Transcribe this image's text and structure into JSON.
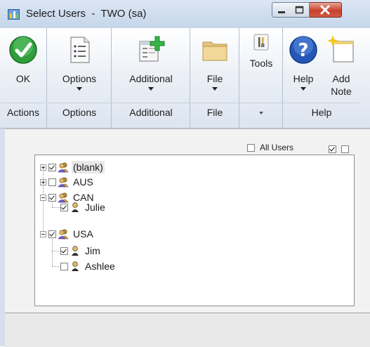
{
  "window": {
    "title": "Select Users  -  TWO (sa)"
  },
  "ribbon": {
    "groups": [
      {
        "label": "Actions",
        "buttons": [
          {
            "label": "OK",
            "icon": "ok-check-icon"
          }
        ]
      },
      {
        "label": "Options",
        "buttons": [
          {
            "label": "Options",
            "icon": "options-list-icon",
            "dropdown": true
          }
        ]
      },
      {
        "label": "Additional",
        "buttons": [
          {
            "label": "Additional",
            "icon": "additional-window-icon",
            "dropdown": true
          }
        ]
      },
      {
        "label": "File",
        "buttons": [
          {
            "label": "File",
            "icon": "folder-icon",
            "dropdown": true
          }
        ]
      },
      {
        "label": "",
        "buttons": [
          {
            "label": "Tools",
            "icon": "tools-icon"
          }
        ]
      },
      {
        "label": "Help",
        "buttons": [
          {
            "label": "Help",
            "icon": "help-icon",
            "dropdown": true
          },
          {
            "label": "Add\nNote",
            "icon": "add-note-icon"
          }
        ]
      }
    ]
  },
  "filter": {
    "all_users_label": "All Users",
    "all_users_checked": false,
    "mark_all": true,
    "unmark_all": false
  },
  "tree": [
    {
      "label": "(blank)",
      "level": 0,
      "checked": true,
      "expander": "plus",
      "icon": "user-group-icon",
      "selected": true
    },
    {
      "label": "AUS",
      "level": 0,
      "checked": false,
      "expander": "plus",
      "icon": "user-group-icon"
    },
    {
      "label": "CAN",
      "level": 0,
      "checked": true,
      "expander": "minus",
      "icon": "user-group-icon"
    },
    {
      "label": "Julie",
      "level": 1,
      "checked": true,
      "icon": "user-icon"
    },
    {
      "label": "USA",
      "level": 0,
      "checked": true,
      "expander": "minus",
      "icon": "user-group-icon"
    },
    {
      "label": "Jim",
      "level": 1,
      "checked": true,
      "icon": "user-icon"
    },
    {
      "label": "Ashlee",
      "level": 1,
      "checked": false,
      "icon": "user-icon"
    }
  ]
}
